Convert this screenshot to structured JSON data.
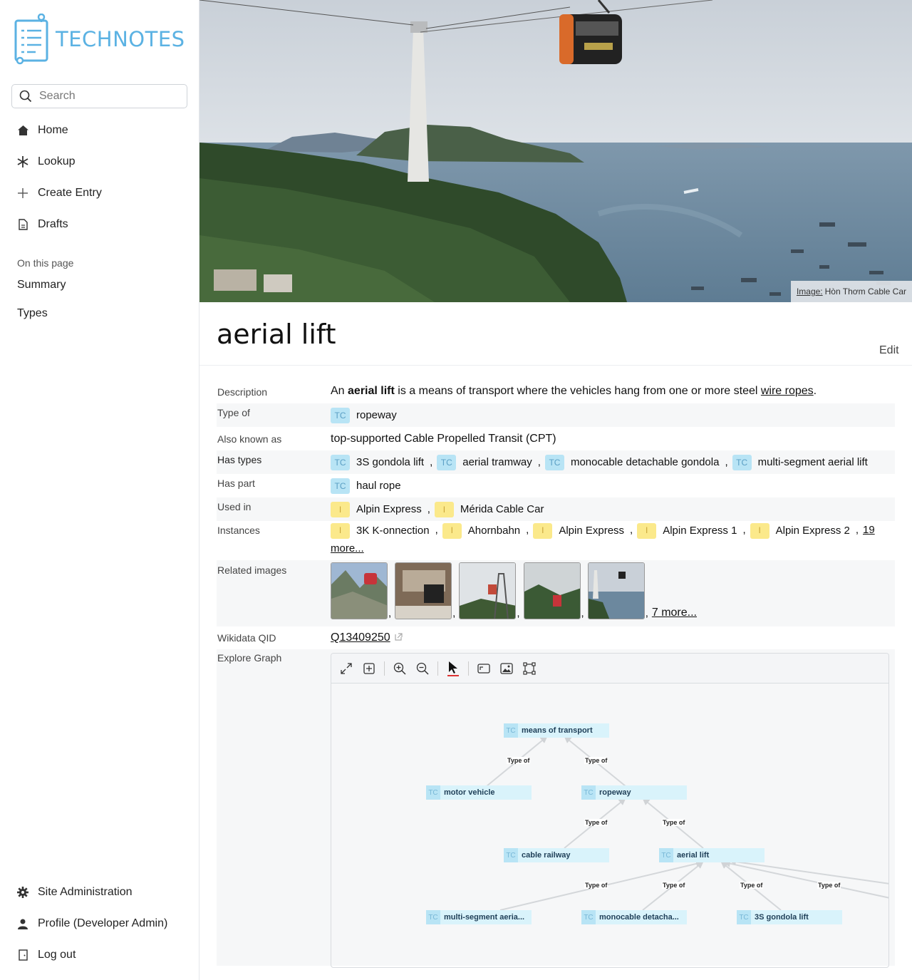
{
  "app": {
    "name": "TECHNOTES"
  },
  "search": {
    "placeholder": "Search"
  },
  "nav": {
    "items": [
      {
        "label": "Home",
        "icon": "home-icon"
      },
      {
        "label": "Lookup",
        "icon": "asterisk-icon"
      },
      {
        "label": "Create Entry",
        "icon": "plus-icon"
      },
      {
        "label": "Drafts",
        "icon": "document-icon"
      }
    ]
  },
  "on_this_page": {
    "title": "On this page",
    "items": [
      "Summary",
      "Types"
    ]
  },
  "bottom_nav": {
    "items": [
      {
        "label": "Site Administration",
        "icon": "gear-icon"
      },
      {
        "label": "Profile (Developer Admin)",
        "icon": "user-icon"
      },
      {
        "label": "Log out",
        "icon": "logout-icon"
      }
    ]
  },
  "hero": {
    "caption_label": "Image:",
    "caption_text": "Hòn Thơm Cable Car"
  },
  "page": {
    "title": "aerial lift",
    "edit_label": "Edit"
  },
  "props": {
    "description": {
      "key": "Description",
      "pre": "An ",
      "bold": "aerial lift",
      "mid": " is a means of transport where the vehicles hang from one or more steel ",
      "link": "wire ropes",
      "post": "."
    },
    "type_of": {
      "key": "Type of",
      "items": [
        {
          "badge": "TC",
          "name": "ropeway"
        }
      ]
    },
    "also_known_as": {
      "key": "Also known as",
      "value": "top-supported Cable Propelled Transit (CPT)"
    },
    "has_types": {
      "key": "Has types",
      "items": [
        {
          "badge": "TC",
          "name": "3S gondola lift"
        },
        {
          "badge": "TC",
          "name": "aerial tramway"
        },
        {
          "badge": "TC",
          "name": "monocable detachable gondola"
        },
        {
          "badge": "TC",
          "name": "multi-segment aerial lift"
        }
      ]
    },
    "has_part": {
      "key": "Has part",
      "items": [
        {
          "badge": "TC",
          "name": "haul rope"
        }
      ]
    },
    "used_in": {
      "key": "Used in",
      "items": [
        {
          "badge": "I",
          "name": "Alpin Express"
        },
        {
          "badge": "I",
          "name": "Mérida Cable Car"
        }
      ]
    },
    "instances": {
      "key": "Instances",
      "items": [
        {
          "badge": "I",
          "name": "3K K-onnection"
        },
        {
          "badge": "I",
          "name": "Ahornbahn"
        },
        {
          "badge": "I",
          "name": "Alpin Express"
        },
        {
          "badge": "I",
          "name": "Alpin Express 1"
        },
        {
          "badge": "I",
          "name": "Alpin Express 2"
        }
      ],
      "more_count": "19",
      "more_suffix": "more..."
    },
    "related_images": {
      "key": "Related images",
      "more": "7 more..."
    },
    "wikidata": {
      "key": "Wikidata QID",
      "value": "Q13409250"
    },
    "explore_graph": {
      "key": "Explore Graph"
    }
  },
  "graph": {
    "nodes": [
      {
        "badge": "TC",
        "label": "means of transport"
      },
      {
        "badge": "TC",
        "label": "motor vehicle"
      },
      {
        "badge": "TC",
        "label": "ropeway"
      },
      {
        "badge": "TC",
        "label": "cable railway"
      },
      {
        "badge": "TC",
        "label": "aerial lift"
      },
      {
        "badge": "TC",
        "label": "multi-segment aeria..."
      },
      {
        "badge": "TC",
        "label": "monocable detacha..."
      },
      {
        "badge": "TC",
        "label": "3S gondola lift"
      }
    ],
    "edge_label": "Type of",
    "toolbar": [
      "expand-icon",
      "add-node-icon",
      "zoom-in-icon",
      "zoom-out-icon",
      "pointer-icon",
      "fit-icon",
      "image-icon",
      "select-area-icon"
    ]
  },
  "colors": {
    "accent": "#5bb2e3",
    "tc_badge": "#b8e4f5",
    "instance_badge": "#fbe98b",
    "graph_node": "#d9f3fb"
  }
}
